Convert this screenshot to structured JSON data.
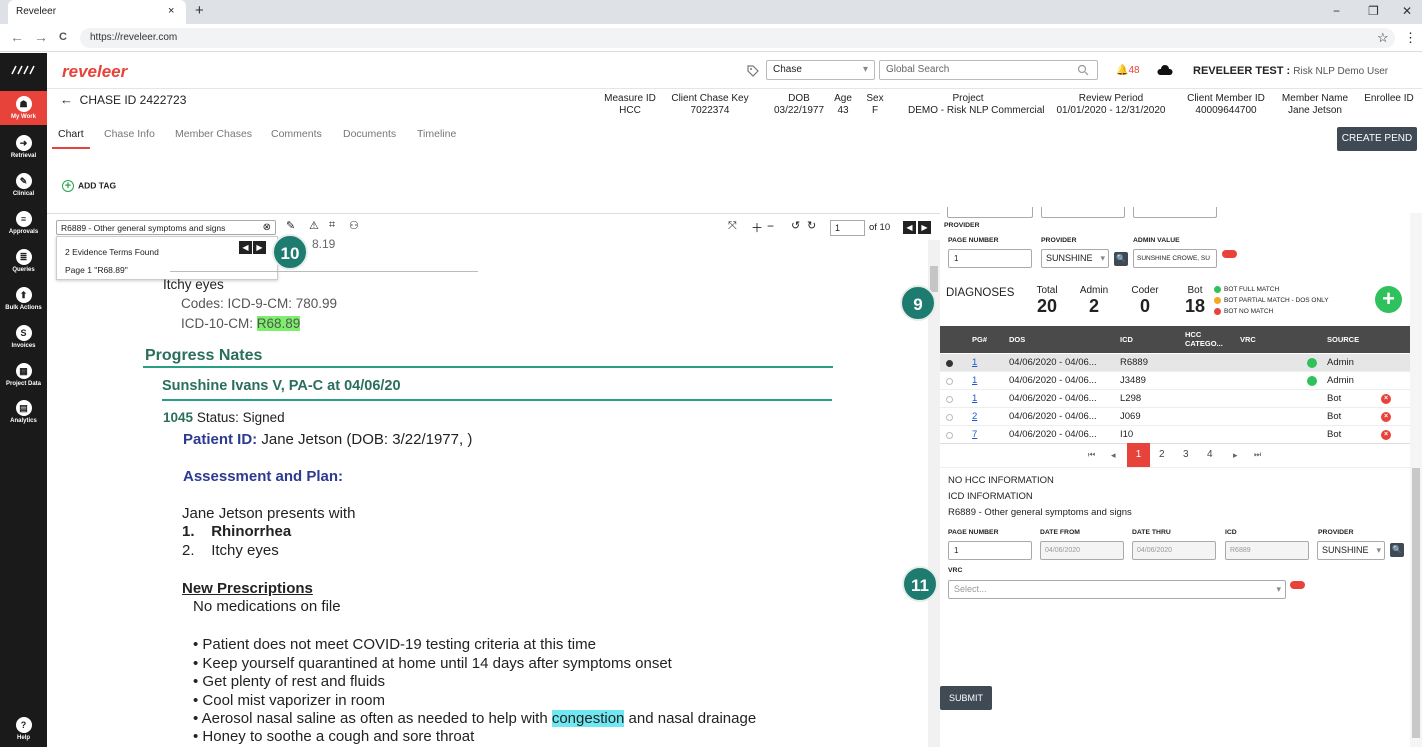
{
  "browser": {
    "tab_title": "Reveleer",
    "tab_close": "×",
    "new_tab": "+",
    "url": "https://reveleer.com",
    "back_icon": "←",
    "forward_icon": "→",
    "reload_icon": "C",
    "minimize_icon": "−",
    "restore_icon": "❐",
    "close_icon": "✕",
    "star_icon": "☆",
    "menu_icon": "⋮"
  },
  "app": {
    "logo": "reveleer",
    "chase_select": "Chase",
    "global_search_placeholder": "Global Search",
    "alert_count": "48",
    "user_label": "REVELEER TEST :",
    "user_role": "Risk NLP Demo User"
  },
  "sidebar": [
    {
      "label": "My Work",
      "icon": "☗"
    },
    {
      "label": "Retrieval",
      "icon": "➜"
    },
    {
      "label": "Clinical",
      "icon": "✎"
    },
    {
      "label": "Approvals",
      "icon": "≡"
    },
    {
      "label": "Queries",
      "icon": "≣"
    },
    {
      "label": "Bulk Actions",
      "icon": "⬆"
    },
    {
      "label": "Invoices",
      "icon": "S"
    },
    {
      "label": "Project Data",
      "icon": "▦"
    },
    {
      "label": "Analytics",
      "icon": "▤"
    },
    {
      "label": "Help",
      "icon": "?"
    }
  ],
  "chase": {
    "title": "CHASE ID 2422723",
    "fields": [
      {
        "label": "Measure ID",
        "value": "HCC"
      },
      {
        "label": "Client Chase Key",
        "value": "7022374"
      },
      {
        "label": "DOB",
        "value": "03/22/1977"
      },
      {
        "label": "Age",
        "value": "43"
      },
      {
        "label": "Sex",
        "value": "F"
      },
      {
        "label": "Project",
        "value": "DEMO - Risk NLP Commercial"
      },
      {
        "label": "Review Period",
        "value": "01/01/2020 - 12/31/2020"
      },
      {
        "label": "Client Member ID",
        "value": "40009644700"
      },
      {
        "label": "Member Name",
        "value": "Jane Jetson"
      },
      {
        "label": "Enrollee ID",
        "value": ""
      }
    ]
  },
  "tabs": [
    "Chart",
    "Chase Info",
    "Member Chases",
    "Comments",
    "Documents",
    "Timeline"
  ],
  "create_pend": "CREATE PEND",
  "add_tag": "ADD TAG",
  "viewer": {
    "evidence_query": "R6889 - Other general symptoms and signs",
    "evidence_found": "2 Evidence Terms Found",
    "evidence_page": "Page 1 \"R68.89\"",
    "page_value": "1",
    "page_total": "of 10",
    "hidden_code_tail": "8.19"
  },
  "document": {
    "symptom": "Itchy eyes",
    "codes_line": "Codes: ICD-9-CM: 780.99",
    "icd10_prefix": "ICD-10-CM:",
    "icd10_code": "R68.89",
    "section": "Progress Nates",
    "provider_line": "Sunshine Ivans V, PA-C at 04/06/20",
    "time": "1045",
    "status": "Status: Signed",
    "patient_label": "Patient ID:",
    "patient_value": "Jane Jetson (DOB: 3/22/1977, )",
    "assessment": "Assessment and Plan:",
    "presents": "Jane Jetson  presents with",
    "item1_num": "1.",
    "item1": "Rhinorrhea",
    "item2_num": "2.",
    "item2": "Itchy eyes",
    "rx_title": "New Prescriptions",
    "rx_none": "No medications on file",
    "bullets": [
      "Patient does not meet COVID-19 testing criteria at this time",
      "Keep yourself quarantined at home until  14 days after symptoms onset",
      "Get plenty of rest and fluids",
      "Cool mist vaporizer in room"
    ],
    "bullet5_pre": "Aerosol nasal saline as often as needed to help with ",
    "bullet5_hl": "congestion",
    "bullet5_post": " and nasal drainage",
    "bullet6": "Honey to soothe a cough and sore throat"
  },
  "right_panel": {
    "provider_section": "PROVIDER",
    "page_number_label": "PAGE NUMBER",
    "page_number": "1",
    "provider_label": "PROVIDER",
    "provider_value": "SUNSHINE",
    "admin_value_label": "ADMIN VALUE",
    "admin_value": "SUNSHINE CROWE, SU",
    "diagnoses_title": "DIAGNOSES",
    "stats": [
      {
        "label": "Total",
        "value": "20"
      },
      {
        "label": "Admin",
        "value": "2"
      },
      {
        "label": "Coder",
        "value": "0"
      },
      {
        "label": "Bot",
        "value": "18"
      }
    ],
    "legend": [
      {
        "label": "BOT FULL MATCH",
        "color": "#2fc15b"
      },
      {
        "label": "BOT PARTIAL MATCH - DOS ONLY",
        "color": "#f5a623"
      },
      {
        "label": "BOT NO MATCH",
        "color": "#e8433b"
      }
    ],
    "table_headers": [
      "PG#",
      "DOS",
      "ICD",
      "HCC CATEGO...",
      "VRC",
      "SOURCE"
    ],
    "rows": [
      {
        "pg": "1",
        "dos": "04/06/2020 - 04/06...",
        "icd": "R6889",
        "source": "Admin",
        "status": "match"
      },
      {
        "pg": "1",
        "dos": "04/06/2020 - 04/06...",
        "icd": "J3489",
        "source": "Admin",
        "status": "match"
      },
      {
        "pg": "1",
        "dos": "04/06/2020 - 04/06...",
        "icd": "L298",
        "source": "Bot",
        "status": "nomatch"
      },
      {
        "pg": "2",
        "dos": "04/06/2020 - 04/06...",
        "icd": "J069",
        "source": "Bot",
        "status": "nomatch"
      },
      {
        "pg": "7",
        "dos": "04/06/2020 - 04/06...",
        "icd": "I10",
        "source": "Bot",
        "status": "nomatch"
      }
    ],
    "pages": [
      "1",
      "2",
      "3",
      "4"
    ],
    "pager_first": "⏮",
    "pager_prev": "◂",
    "pager_next": "▸",
    "pager_last": "⏭",
    "no_hcc": "NO HCC INFORMATION",
    "icd_info": "ICD INFORMATION",
    "icd_desc": "R6889 - Other general symptoms and signs",
    "form_labels": {
      "page": "PAGE NUMBER",
      "from": "DATE FROM",
      "thru": "DATE THRU",
      "icd": "ICD",
      "provider": "PROVIDER",
      "vrc": "VRC"
    },
    "form_values": {
      "page": "1",
      "from": "04/06/2020",
      "thru": "04/06/2020",
      "icd": "R6889",
      "provider": "SUNSHINE"
    },
    "vrc_placeholder": "Select...",
    "submit": "SUBMIT"
  },
  "badges": {
    "b9": "9",
    "b10": "10",
    "b11": "11"
  }
}
